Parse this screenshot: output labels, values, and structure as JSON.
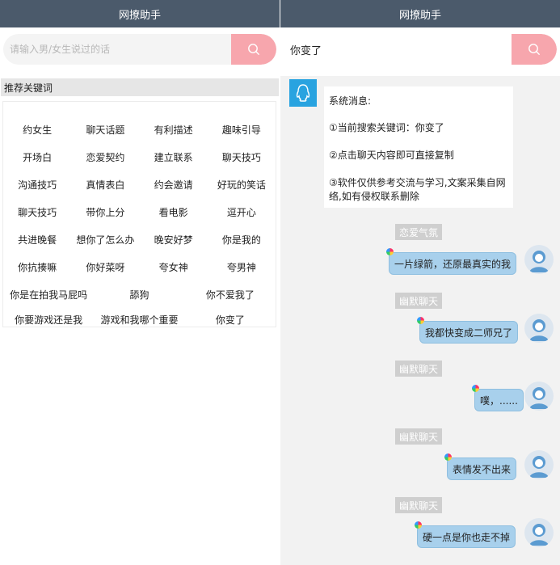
{
  "app_title": "网撩助手",
  "left": {
    "search_placeholder": "请输入男/女生说过的话",
    "section_title": "推荐关键词",
    "keyword_rows": [
      [
        "约女生",
        "聊天话题",
        "有利描述",
        "趣味引导"
      ],
      [
        "开场白",
        "恋爱契约",
        "建立联系",
        "聊天技巧"
      ],
      [
        "沟通技巧",
        "真情表白",
        "约会邀请",
        "好玩的笑话"
      ],
      [
        "聊天技巧",
        "带你上分",
        "看电影",
        "逗开心"
      ],
      [
        "共进晚餐",
        "想你了怎么办",
        "晚安好梦",
        "你是我的"
      ],
      [
        "你抗揍嘛",
        "你好菜呀",
        "夸女神",
        "夸男神"
      ],
      [
        "你是在拍我马屁吗",
        "舔狗",
        "你不爱我了"
      ],
      [
        "你要游戏还是我",
        "游戏和我哪个重要",
        "你变了"
      ]
    ]
  },
  "right": {
    "search_value": "你变了",
    "system_message": {
      "heading": "系统消息:",
      "line1": "①当前搜索关键词：你变了",
      "line2": "②点击聊天内容即可直接复制",
      "line3": "③软件仅供参考交流与学习,文案采集自网络,如有侵权联系删除"
    },
    "messages": [
      {
        "tag": "恋爱气氛",
        "text": "一片绿箭，还原最真实的我"
      },
      {
        "tag": "幽默聊天",
        "text": "我都快变成二师兄了"
      },
      {
        "tag": "幽默聊天",
        "text": "噗，......"
      },
      {
        "tag": "幽默聊天",
        "text": "表情发不出来"
      },
      {
        "tag": "幽默聊天",
        "text": "硬一点是你也走不掉"
      }
    ]
  },
  "colors": {
    "titlebar": "#4b5a6b",
    "search_button": "#f7a6ad",
    "bubble": "#a8d0ec",
    "tag": "#cfcfcf",
    "qq_icon": "#29a3e0"
  },
  "icons": {
    "search": "search-icon",
    "qq": "qq-penguin-icon",
    "avatar": "user-avatar-icon"
  }
}
